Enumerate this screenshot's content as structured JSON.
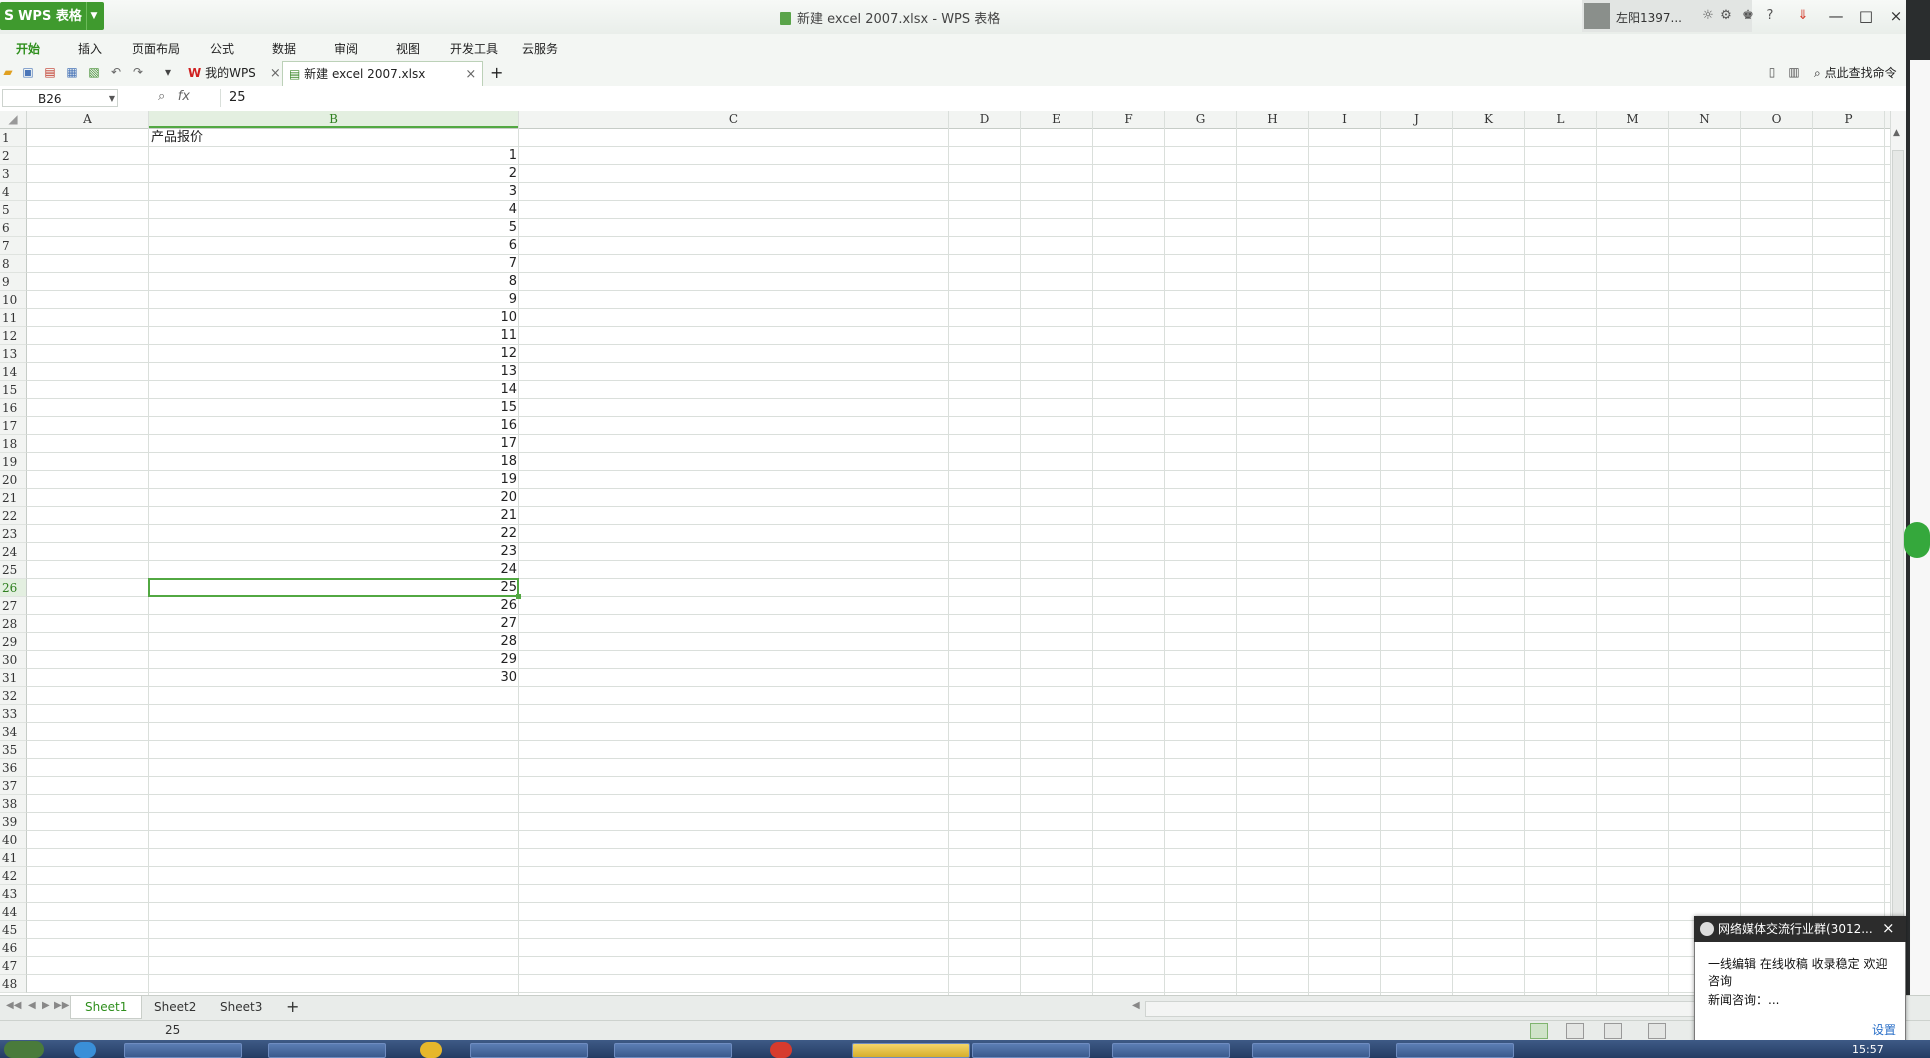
{
  "window": {
    "app_button": "WPS 表格",
    "title": "新建 excel 2007.xlsx - WPS 表格",
    "user": "左阳1397...",
    "controls": [
      "—",
      "□",
      "×"
    ]
  },
  "menu": [
    "开始",
    "插入",
    "页面布局",
    "公式",
    "数据",
    "审阅",
    "视图",
    "开发工具",
    "云服务"
  ],
  "tabs": [
    {
      "label": "我的WPS",
      "close": "×"
    },
    {
      "label": "新建 excel 2007.xlsx",
      "close": "×"
    }
  ],
  "new_tab": "+",
  "right_tools": {
    "search": "点此查找命令"
  },
  "formula_bar": {
    "name_box": "B26",
    "fx": "fx",
    "value": "25"
  },
  "columns": [
    "A",
    "B",
    "C",
    "D",
    "E",
    "F",
    "G",
    "H",
    "I",
    "J",
    "K",
    "L",
    "M",
    "N",
    "O",
    "P"
  ],
  "rows": [
    "1",
    "2",
    "3",
    "4",
    "5",
    "6",
    "7",
    "8",
    "9",
    "10",
    "11",
    "12",
    "13",
    "14",
    "15",
    "16",
    "17",
    "18",
    "19",
    "20",
    "21",
    "22",
    "23",
    "24",
    "25",
    "26",
    "27",
    "28",
    "29",
    "30",
    "31",
    "32",
    "33",
    "34",
    "35",
    "36",
    "37",
    "38",
    "39",
    "40",
    "41",
    "42",
    "43",
    "44",
    "45",
    "46",
    "47",
    "48"
  ],
  "cells": {
    "B1": "产品报价",
    "B_values": [
      "1",
      "2",
      "3",
      "4",
      "5",
      "6",
      "7",
      "8",
      "9",
      "10",
      "11",
      "12",
      "13",
      "14",
      "15",
      "16",
      "17",
      "18",
      "19",
      "20",
      "21",
      "22",
      "23",
      "24",
      "25",
      "26",
      "27",
      "28",
      "29",
      "30"
    ]
  },
  "selected_cell": "B26",
  "selected_column": "B",
  "selected_row": "26",
  "sheets": [
    "Sheet1",
    "Sheet2",
    "Sheet3"
  ],
  "active_sheet": "Sheet1",
  "add_sheet": "+",
  "status": {
    "value": "25"
  },
  "popup": {
    "title": "网络媒体交流行业群(3012...",
    "close": "×",
    "line1": "一线编辑 在线收稿 收录稳定 欢迎咨询",
    "line2": "新闻咨询：...",
    "settings": "设置"
  },
  "taskbar": {
    "clock": "15:57"
  },
  "colors": {
    "accent": "#3f9a2e",
    "selection": "#52a842"
  }
}
